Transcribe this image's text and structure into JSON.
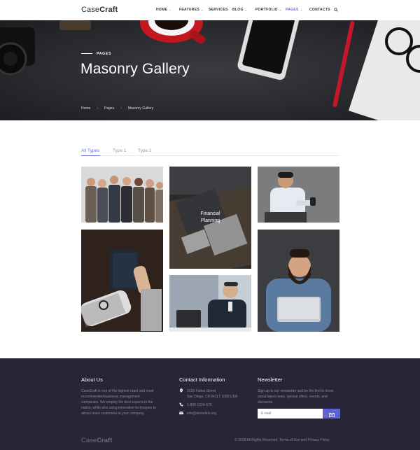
{
  "header": {
    "logo_light": "Case",
    "logo_bold": "Craft",
    "nav": [
      {
        "label": "HOME",
        "dropdown": true
      },
      {
        "label": "FEATURES",
        "dropdown": true
      },
      {
        "label": "SERVICES",
        "dropdown": false
      },
      {
        "label": "BLOG",
        "dropdown": true
      },
      {
        "label": "PORTFOLIO",
        "dropdown": true
      },
      {
        "label": "PAGES",
        "dropdown": true,
        "active": true
      },
      {
        "label": "CONTACTS",
        "dropdown": false
      }
    ],
    "search_icon": "search-icon",
    "accent_color": "#6a6ed6"
  },
  "hero": {
    "label": "PAGES",
    "title": "Masonry Gallery",
    "breadcrumbs": [
      "Home",
      "Pages",
      "Masonry Gallery"
    ]
  },
  "filters": {
    "items": [
      "All Types",
      "Type 1",
      "Type 2"
    ],
    "active": "All Types"
  },
  "gallery": {
    "tiles": [
      {
        "name": "business-team-photo",
        "caption": ""
      },
      {
        "name": "financial-planning-photo",
        "caption": "Financial Planning"
      },
      {
        "name": "man-with-phone-photo",
        "caption": ""
      },
      {
        "name": "notebook-watch-photo",
        "caption": ""
      },
      {
        "name": "man-at-laptop-photo",
        "caption": ""
      },
      {
        "name": "bearded-man-laptop-photo",
        "caption": ""
      }
    ]
  },
  "footer": {
    "about_title": "About Us",
    "about_text": "CaseCraft is one of the highest rated and most recommended business management companies. We employ the best experts in the nation, while also using innovative techniques to attract more customers to your company.",
    "contact_title": "Contact Information",
    "address_line1": "3120 Fulton Street",
    "address_line2": "San Diego, CA 94117-1080 USA",
    "phone": "1-800-1234-678",
    "email": "info@demolink.org",
    "newsletter_title": "Newsletter",
    "newsletter_text": "Sign up to our newsletter and be the first to know about latest news, special offers, events, and discounts.",
    "newsletter_placeholder": "E-mail",
    "logo_light": "Case",
    "logo_bold": "Craft",
    "copyright": "© 2018 All Rights Reserved. Terms of Use and Privacy Policy",
    "background_color": "#272537",
    "button_color": "#5e62d2"
  }
}
